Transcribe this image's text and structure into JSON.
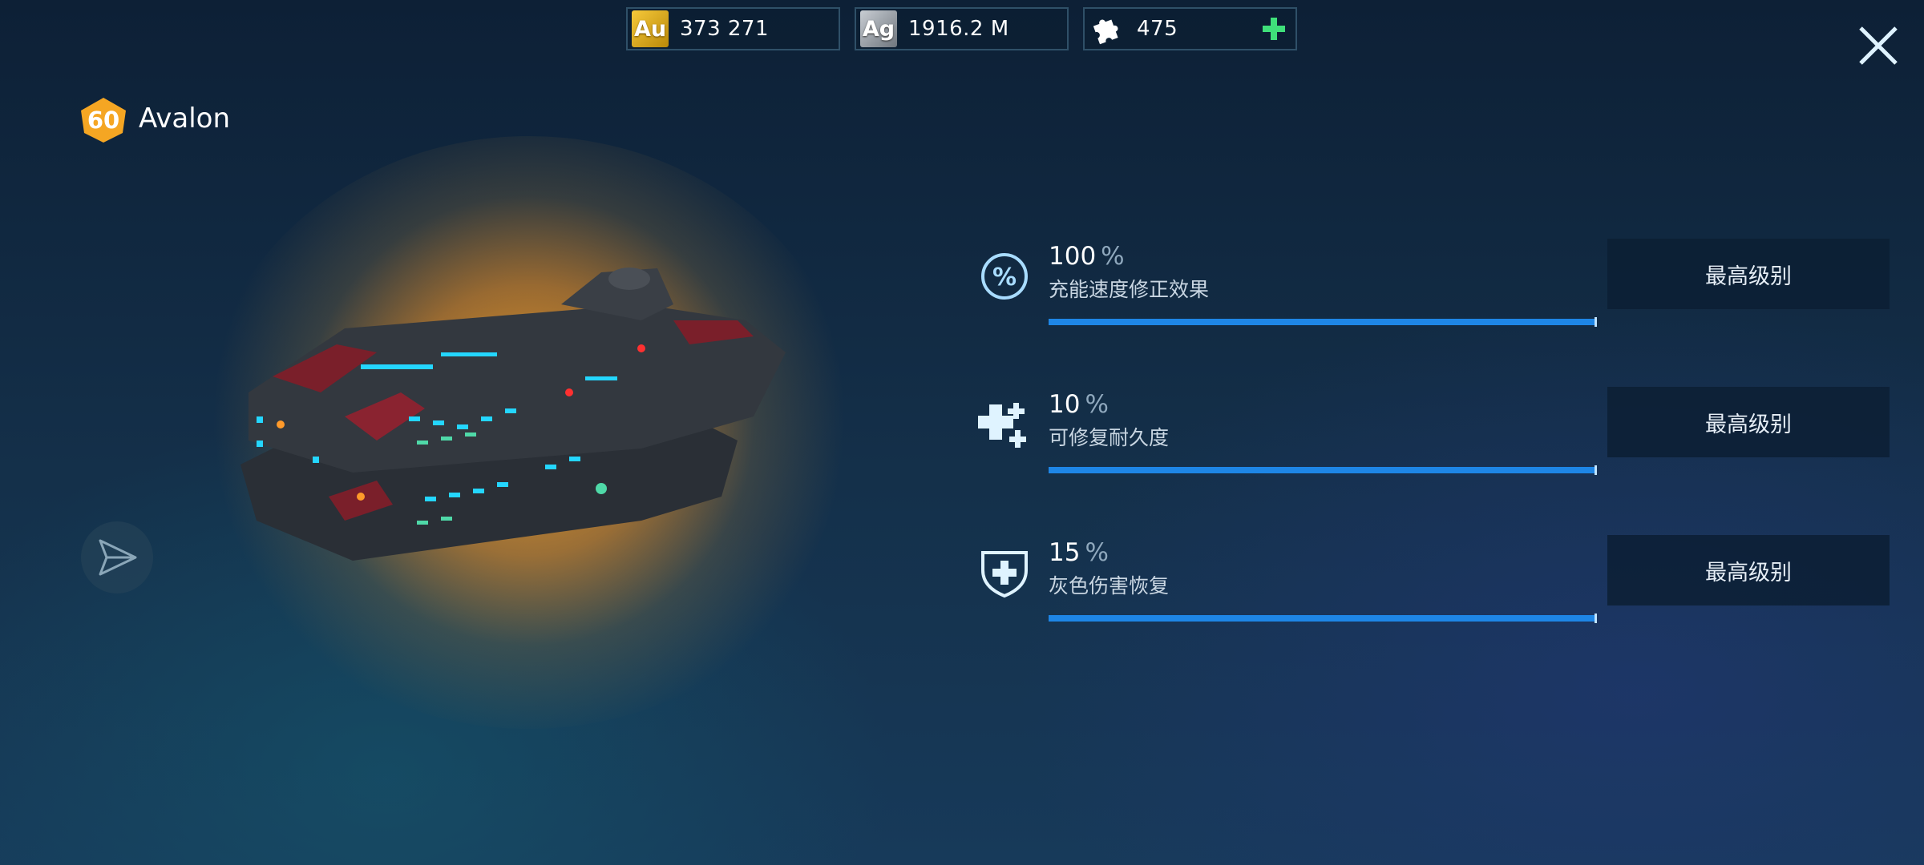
{
  "currency": {
    "gold": {
      "symbol": "Au",
      "value": "373 271"
    },
    "silver": {
      "symbol": "Ag",
      "value": "1916.2 M"
    },
    "parts": {
      "value": "475"
    }
  },
  "ship": {
    "level": "60",
    "name": "Avalon"
  },
  "stats": [
    {
      "value": "100",
      "unit": "%",
      "label": "充能速度修正效果",
      "progress": 1.0,
      "button": "最高级别",
      "icon": "percent-icon"
    },
    {
      "value": "10",
      "unit": "%",
      "label": "可修复耐久度",
      "progress": 1.0,
      "button": "最高级别",
      "icon": "repair-crosses-icon"
    },
    {
      "value": "15",
      "unit": "%",
      "label": "灰色伤害恢复",
      "progress": 1.0,
      "button": "最高级别",
      "icon": "shield-plus-icon"
    }
  ],
  "colors": {
    "accent_blue": "#1e86e6",
    "plus_green": "#3fe07a",
    "badge_gold": "#f5a623"
  }
}
